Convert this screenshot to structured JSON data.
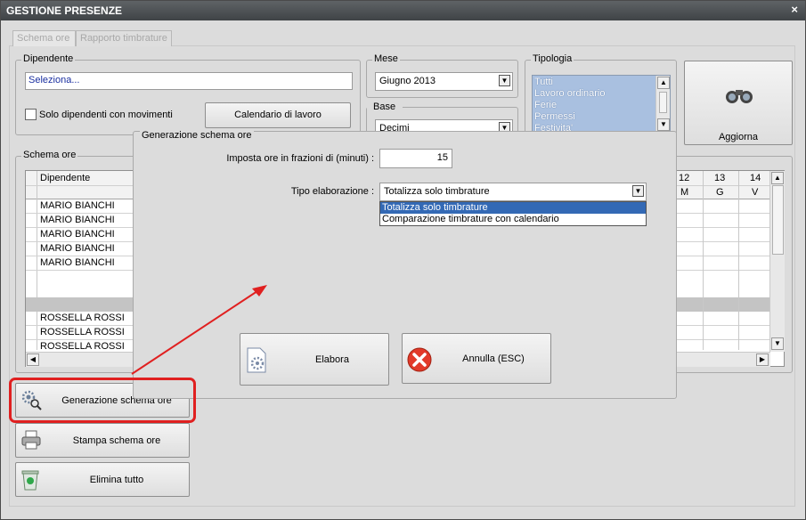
{
  "window": {
    "title": "GESTIONE PRESENZE",
    "close_glyph": "×"
  },
  "tabs": [
    "Schema ore",
    "Rapporto timbrature"
  ],
  "dipendente": {
    "legend": "Dipendente",
    "input_value": "Seleziona...",
    "checkbox_label": "Solo dipendenti con movimenti",
    "calendar_button": "Calendario di lavoro"
  },
  "mese": {
    "legend": "Mese",
    "value": "Giugno 2013"
  },
  "base": {
    "legend": "Base",
    "value": "Decimi"
  },
  "tipologia": {
    "legend": "Tipologia",
    "items": [
      "Tutti",
      "Lavoro ordinario",
      "Ferie",
      "Permessi",
      "Festivita'"
    ]
  },
  "aggiorna": {
    "label": "Aggiorna",
    "icon": "binoculars-icon"
  },
  "schema": {
    "legend": "Schema ore",
    "col_header": "Dipendente",
    "day_numbers": [
      "12",
      "13",
      "14"
    ],
    "day_letters": [
      "M",
      "G",
      "V"
    ],
    "rows": [
      "MARIO BIANCHI",
      "MARIO BIANCHI",
      "MARIO BIANCHI",
      "MARIO BIANCHI",
      "MARIO BIANCHI",
      "",
      "ROSSELLA ROSSI",
      "ROSSELLA ROSSI",
      "ROSSELLA ROSSI",
      "ROSSELLA ROSSI",
      "ROSSELLA ROSSI"
    ]
  },
  "side_buttons": {
    "generazione": "Generazione schema ore",
    "stampa": "Stampa schema ore",
    "elimina": "Elimina tutto"
  },
  "dialog": {
    "legend": "Generazione schema ore",
    "fraction_label": "Imposta ore in frazioni di (minuti) :",
    "fraction_value": "15",
    "tipo_label": "Tipo elaborazione :",
    "tipo_value": "Totalizza solo timbrature",
    "tipo_options": [
      "Totalizza solo timbrature",
      "Comparazione timbrature con calendario"
    ],
    "elabora": "Elabora",
    "annulla": "Annulla (ESC)"
  },
  "colors": {
    "highlight": "#e02020",
    "selection": "#3369b5",
    "title_bar": "#4a4e51"
  }
}
